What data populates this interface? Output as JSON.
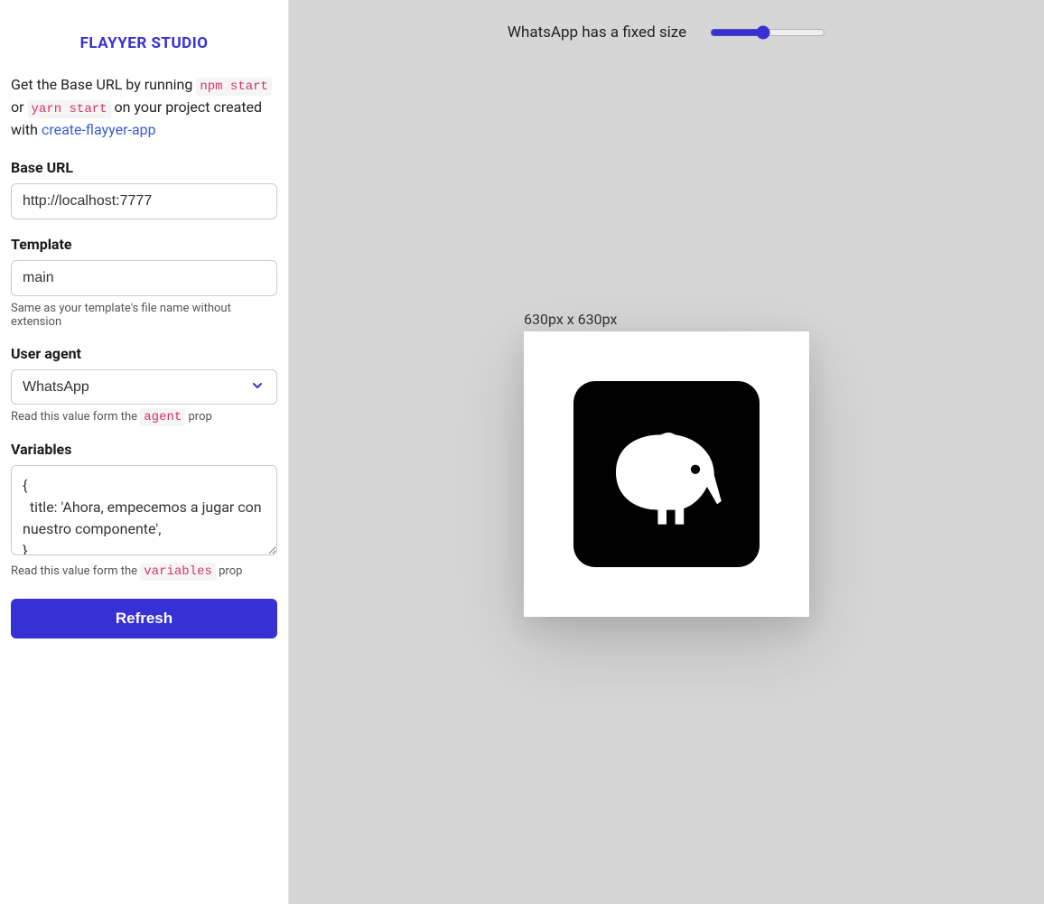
{
  "brand": "FLAYYER STUDIO",
  "intro": {
    "lead": "Get the Base URL by running ",
    "code1": "npm start",
    "or": " or ",
    "code2": "yarn start",
    "tail": " on your project created with ",
    "link": "create-flayyer-app"
  },
  "fields": {
    "baseUrl": {
      "label": "Base URL",
      "value": "http://localhost:7777"
    },
    "template": {
      "label": "Template",
      "value": "main",
      "helper": "Same as your template's file name without extension"
    },
    "userAgent": {
      "label": "User agent",
      "value": "WhatsApp",
      "helperLead": "Read this value form the ",
      "helperCode": "agent",
      "helperTail": " prop"
    },
    "variables": {
      "label": "Variables",
      "value": "{\n  title: 'Ahora, empecemos a jugar con nuestro componente',\n}",
      "helperLead": "Read this value form the ",
      "helperCode": "variables",
      "helperTail": " prop"
    }
  },
  "refreshLabel": "Refresh",
  "canvas": {
    "headerText": "WhatsApp has a fixed size",
    "sliderValue": 45,
    "dimensions": "630px x 630px"
  },
  "colors": {
    "primary": "#3730d4",
    "codePink": "#d6336c",
    "link": "#3b5bdb",
    "canvasBg": "#d6d6d6"
  }
}
